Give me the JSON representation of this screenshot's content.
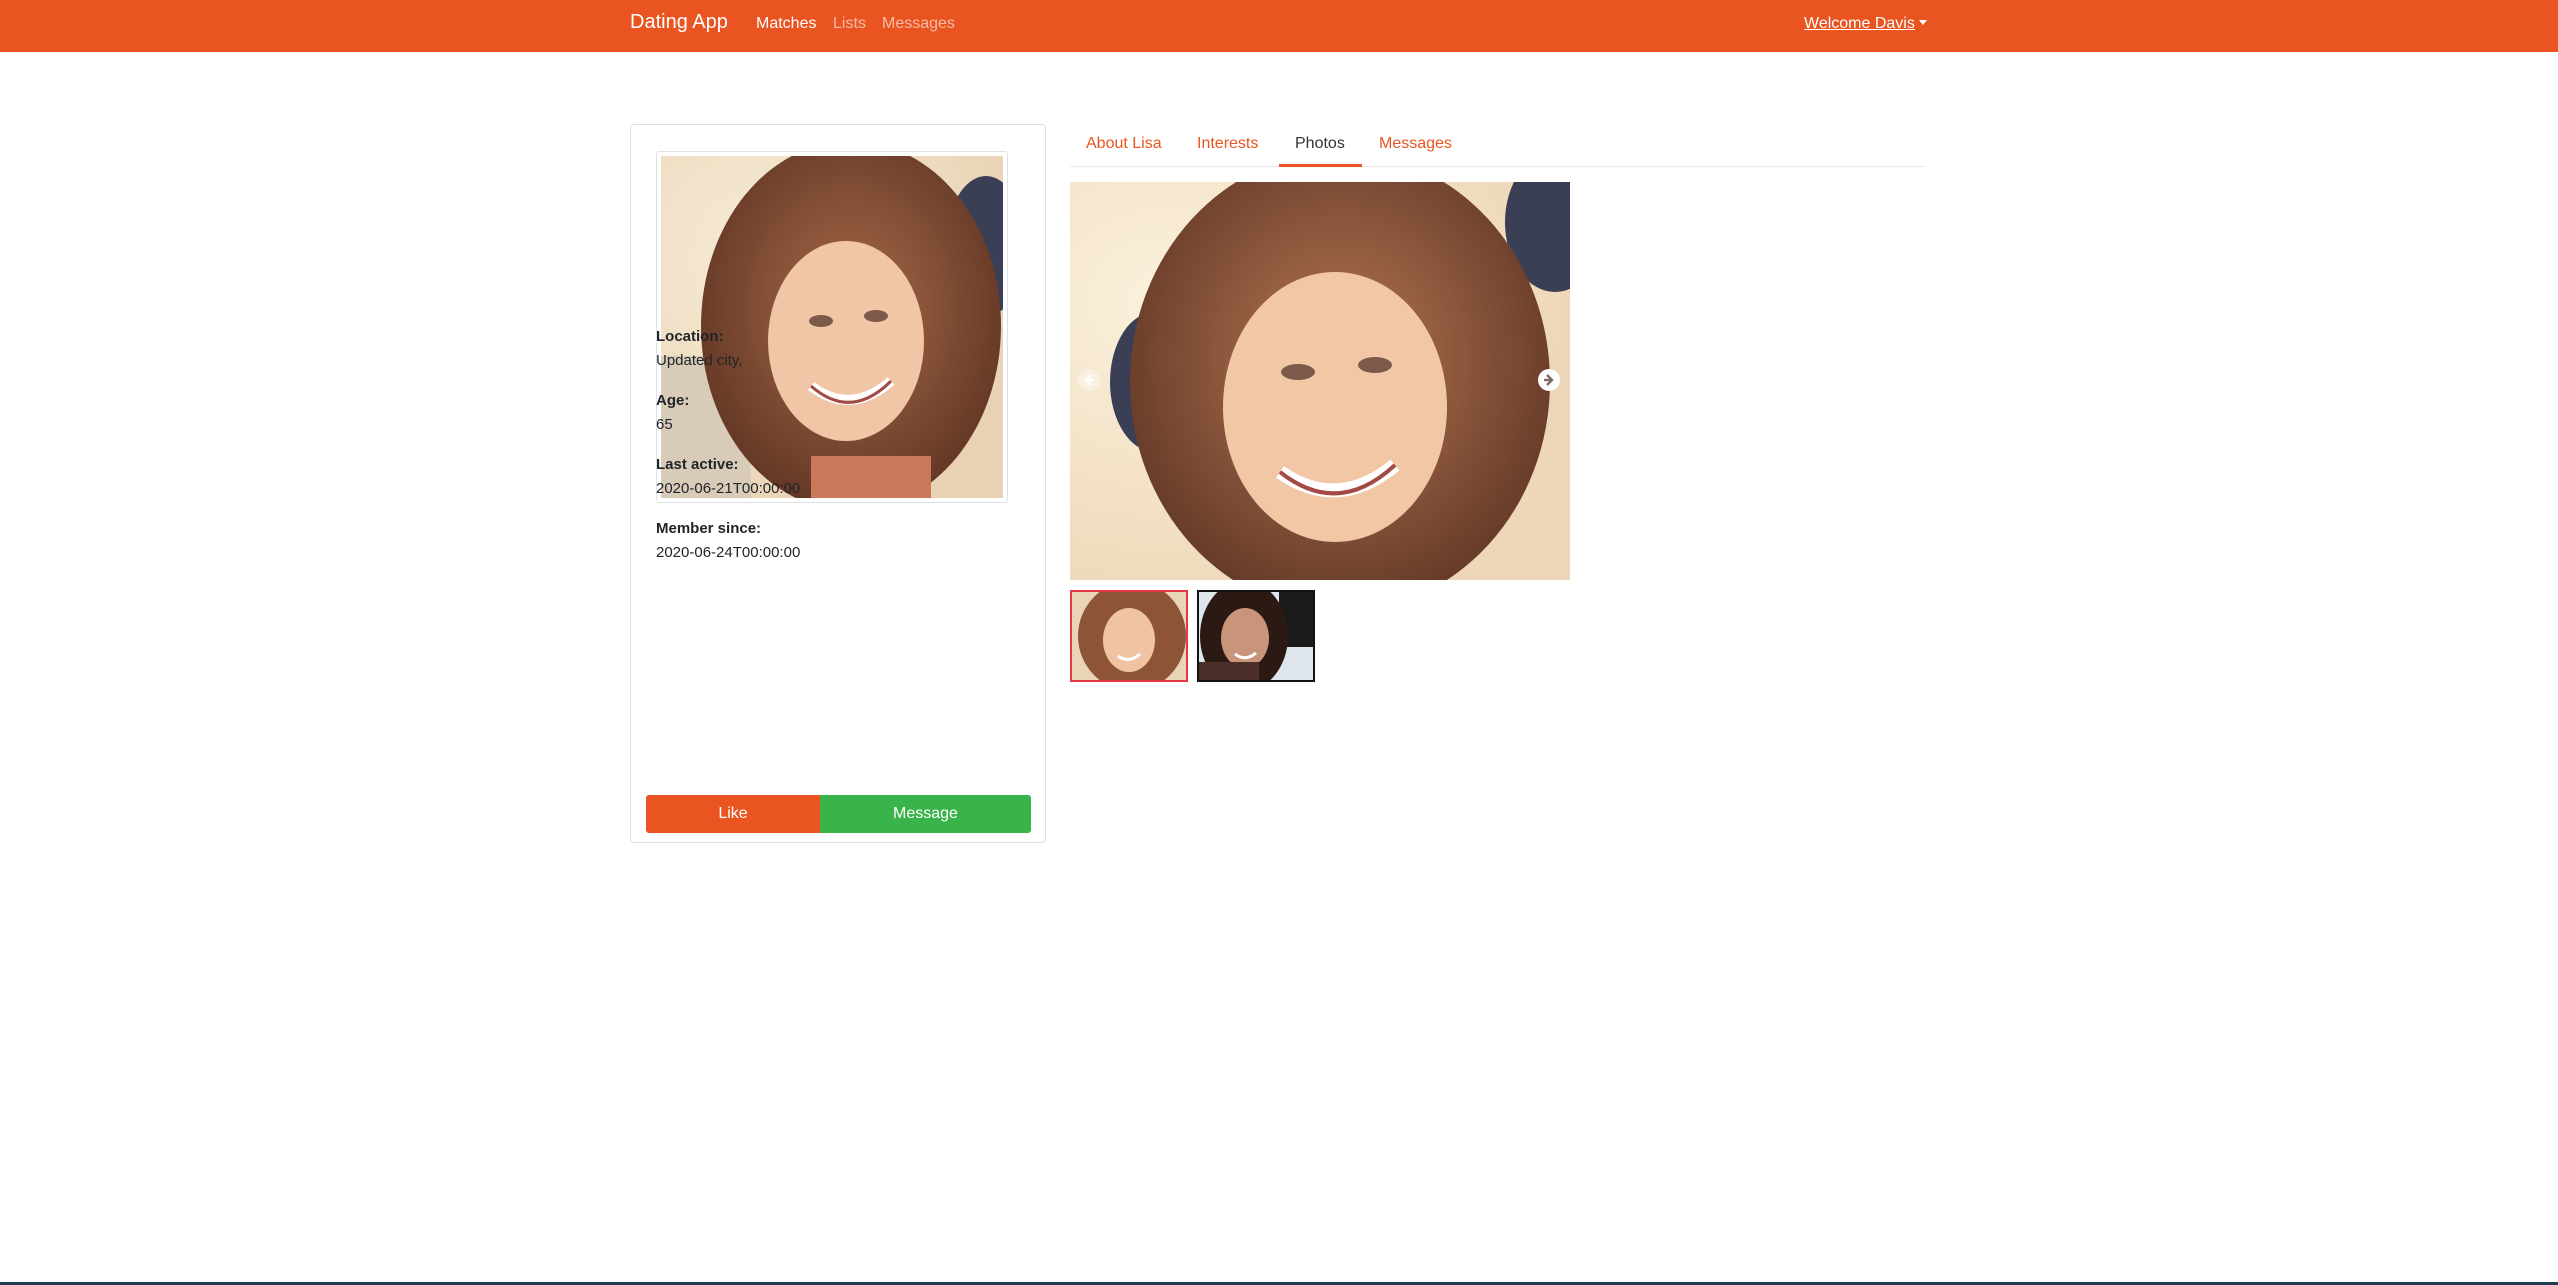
{
  "navbar": {
    "brand": "Dating App",
    "links": [
      {
        "label": "Matches",
        "active": true
      },
      {
        "label": "Lists",
        "active": false
      },
      {
        "label": "Messages",
        "active": false
      }
    ],
    "welcome": "Welcome Davis"
  },
  "profile": {
    "fields": [
      {
        "label": "Location:",
        "value": "Updated city,"
      },
      {
        "label": "Age:",
        "value": "65"
      },
      {
        "label": "Last active:",
        "value": "2020-06-21T00:00:00"
      },
      {
        "label": "Member since:",
        "value": "2020-06-24T00:00:00"
      }
    ],
    "like_label": "Like",
    "message_label": "Message"
  },
  "tabs": [
    {
      "label": "About Lisa",
      "active": false
    },
    {
      "label": "Interests",
      "active": false
    },
    {
      "label": "Photos",
      "active": true
    },
    {
      "label": "Messages",
      "active": false
    }
  ],
  "gallery": {
    "photo_count": 2,
    "selected_index": 0
  },
  "colors": {
    "primary": "#e95420",
    "success": "#38b44a"
  }
}
